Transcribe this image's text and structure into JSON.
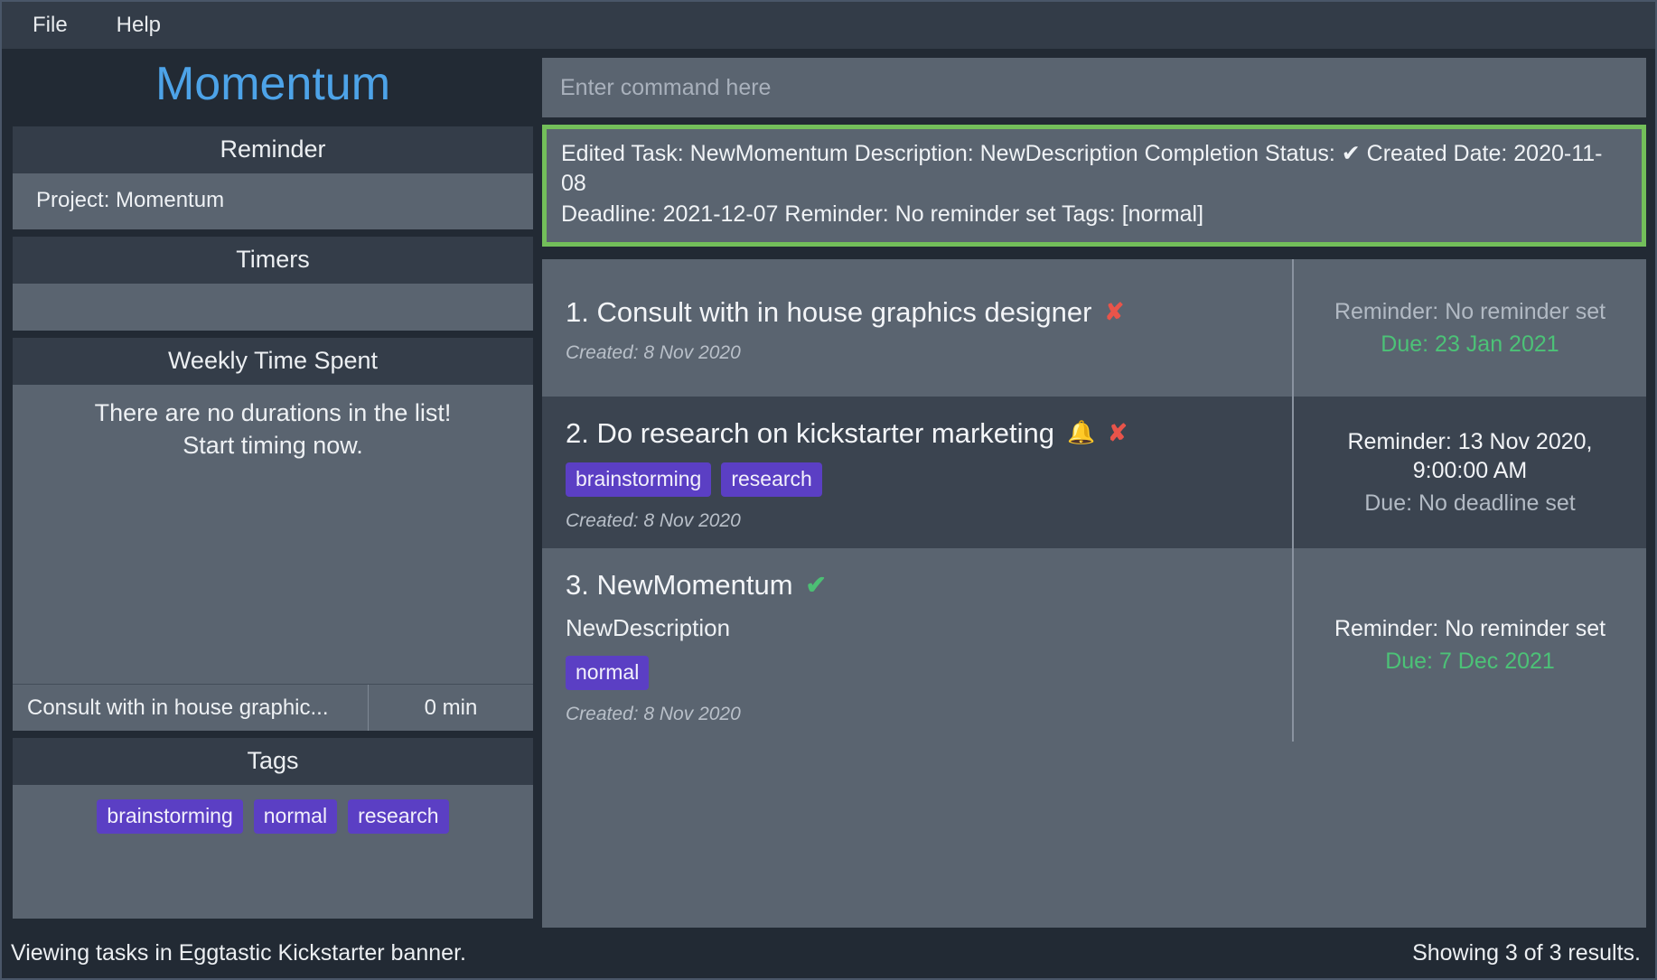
{
  "menubar": {
    "items": [
      {
        "label": "File",
        "name": "menu-file"
      },
      {
        "label": "Help",
        "name": "menu-help"
      }
    ]
  },
  "sidebar": {
    "brand_title": "Momentum",
    "reminder_panel": {
      "header": "Reminder",
      "body_text": "Project: Momentum"
    },
    "timers_panel": {
      "header": "Timers",
      "body_text": ""
    },
    "weekly_panel": {
      "header": "Weekly Time Spent",
      "empty_message_line1": "There are no durations in the list!",
      "empty_message_line2": "Start timing now.",
      "duration_row": {
        "task_name": "Consult with in house graphic...",
        "duration": "0 min"
      }
    },
    "tags_panel": {
      "header": "Tags",
      "tags": [
        "brainstorming",
        "normal",
        "research"
      ]
    }
  },
  "main": {
    "command_input": {
      "placeholder": "Enter command here",
      "value": ""
    },
    "result_box": {
      "border_color": "#73bf5a",
      "line1": "Edited Task: NewMomentum Description: NewDescription Completion Status: ✔ Created Date: 2020-11-08",
      "line2": "Deadline: 2021-12-07 Reminder: No reminder set Tags: [normal]"
    },
    "tasks": [
      {
        "index_title": "1. Consult with in house graphics designer",
        "description": "",
        "tags": [],
        "created": "Created: 8 Nov 2020",
        "status_icon": "cross-icon",
        "status_glyph": "✘",
        "has_bell": false,
        "bell_glyph": "🔔",
        "reminder": "Reminder: No reminder set",
        "reminder_style": "muted",
        "due": "Due: 23 Jan 2021",
        "due_style": "green",
        "row_style": "odd"
      },
      {
        "index_title": "2. Do research on kickstarter marketing",
        "description": "",
        "tags": [
          "brainstorming",
          "research"
        ],
        "created": "Created: 8 Nov 2020",
        "status_icon": "cross-icon",
        "status_glyph": "✘",
        "has_bell": true,
        "bell_glyph": "🔔",
        "reminder": "Reminder: 13 Nov 2020, 9:00:00 AM",
        "reminder_style": "bright",
        "due": "Due: No deadline set",
        "due_style": "muted",
        "row_style": "even"
      },
      {
        "index_title": "3. NewMomentum",
        "description": "NewDescription",
        "tags": [
          "normal"
        ],
        "created": "Created: 8 Nov 2020",
        "status_icon": "check-icon",
        "status_glyph": "✔",
        "has_bell": false,
        "bell_glyph": "🔔",
        "reminder": "Reminder: No reminder set",
        "reminder_style": "bright",
        "due": "Due: 7 Dec 2021",
        "due_style": "green",
        "row_style": "odd"
      }
    ]
  },
  "statusbar": {
    "left_text": "Viewing tasks in Eggtastic Kickstarter banner.",
    "right_text": "Showing 3 of 3 results."
  },
  "colors": {
    "accent_blue": "#4da3e8",
    "tag_purple": "#5b3fc4",
    "success_green": "#4cc277",
    "danger_red": "#e8544a",
    "bell_yellow": "#eab832",
    "result_border_green": "#73bf5a"
  }
}
